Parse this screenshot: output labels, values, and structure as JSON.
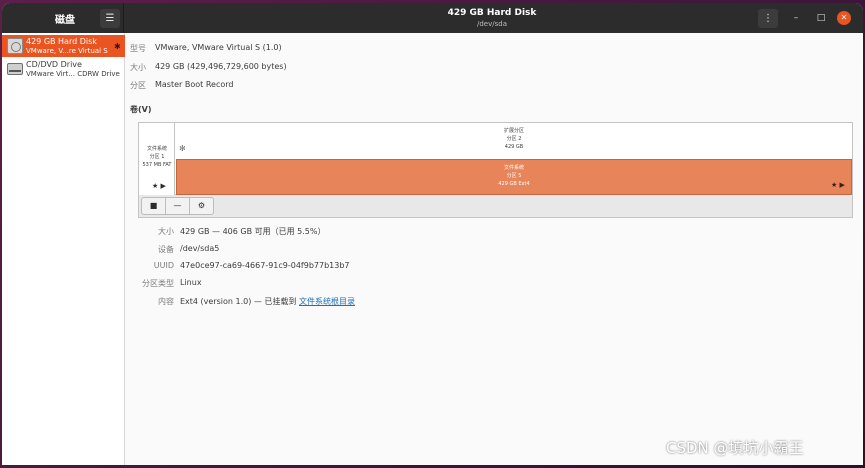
{
  "app": {
    "title": "磁盘"
  },
  "titlebar": {
    "window_title": "429 GB Hard Disk",
    "window_subtitle": "/dev/sda",
    "menu_icon": "hamburger-icon",
    "dots_icon": "vertical-dots-icon",
    "minimize_glyph": "–",
    "maximize_glyph": "□",
    "close_glyph": "✕",
    "close_color": "#e95420"
  },
  "sidebar": {
    "items": [
      {
        "name": "429 GB Hard Disk",
        "desc": "VMware, V...re Virtual S",
        "icon": "hard-disk-icon",
        "selected": true
      },
      {
        "name": "CD/DVD Drive",
        "desc": "VMware Virt... CDRW Drive",
        "icon": "optical-drive-icon",
        "selected": false
      }
    ]
  },
  "disk_info": {
    "model_label": "型号",
    "model_value": "VMware, VMware Virtual S (1.0)",
    "size_label": "大小",
    "size_value": "429 GB (429,496,729,600 bytes)",
    "partition_label": "分区",
    "partition_value": "Master Boot Record"
  },
  "volumes_title": "卷(V)",
  "volume_map": {
    "partition1": {
      "line1": "文件系统",
      "line2": "分区 1",
      "line3": "537 MB FAT"
    },
    "extended": {
      "line1": "扩展分区",
      "line2": "分区 2",
      "line3": "429 GB"
    },
    "partition5": {
      "line1": "文件系统",
      "line2": "分区 5",
      "line3": "429 GB Ext4"
    },
    "selected_color": "#e7845a"
  },
  "volume_toolbar": {
    "stop_glyph": "■",
    "minus_glyph": "—",
    "gear_glyph": "⚙"
  },
  "volume_info": {
    "size_label": "大小",
    "size_value": "429 GB — 406 GB 可用（已用 5.5%）",
    "device_label": "设备",
    "device_value": "/dev/sda5",
    "uuid_label": "UUID",
    "uuid_value": "47e0ce97-ca69-4667-91c9-04f9b77b13b7",
    "type_label": "分区类型",
    "type_value": "Linux",
    "content_label": "内容",
    "content_value": "Ext4 (version 1.0) — 已挂载到",
    "content_link": "文件系统根目录"
  },
  "watermark": "CSDN @填坑小霸王"
}
